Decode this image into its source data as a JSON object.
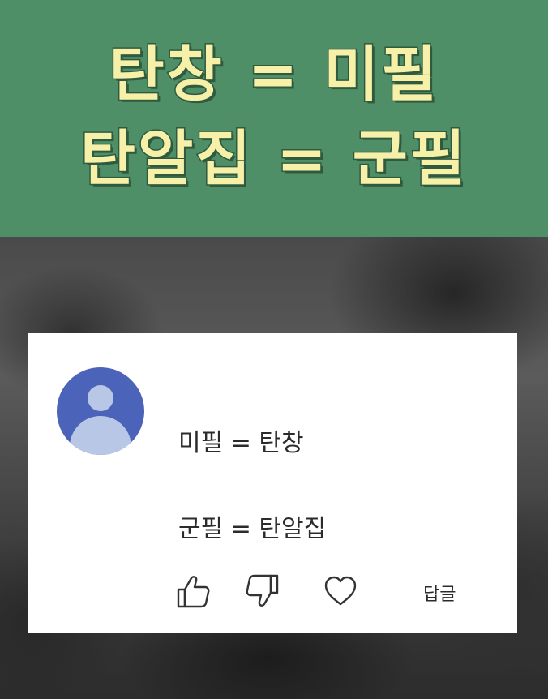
{
  "banner": {
    "line1": "탄창 = 미필",
    "line2": "탄알집 = 군필",
    "text_color": "#f7f0a8",
    "background_color": "#4e8f68"
  },
  "comment": {
    "lines": [
      "미필 = 탄창",
      "군필 = 탄알집"
    ],
    "avatar_color": "#4b63b8",
    "actions": {
      "like_icon": "thumbs-up-icon",
      "dislike_icon": "thumbs-down-icon",
      "favorite_icon": "heart-icon",
      "reply_label": "답글"
    }
  }
}
